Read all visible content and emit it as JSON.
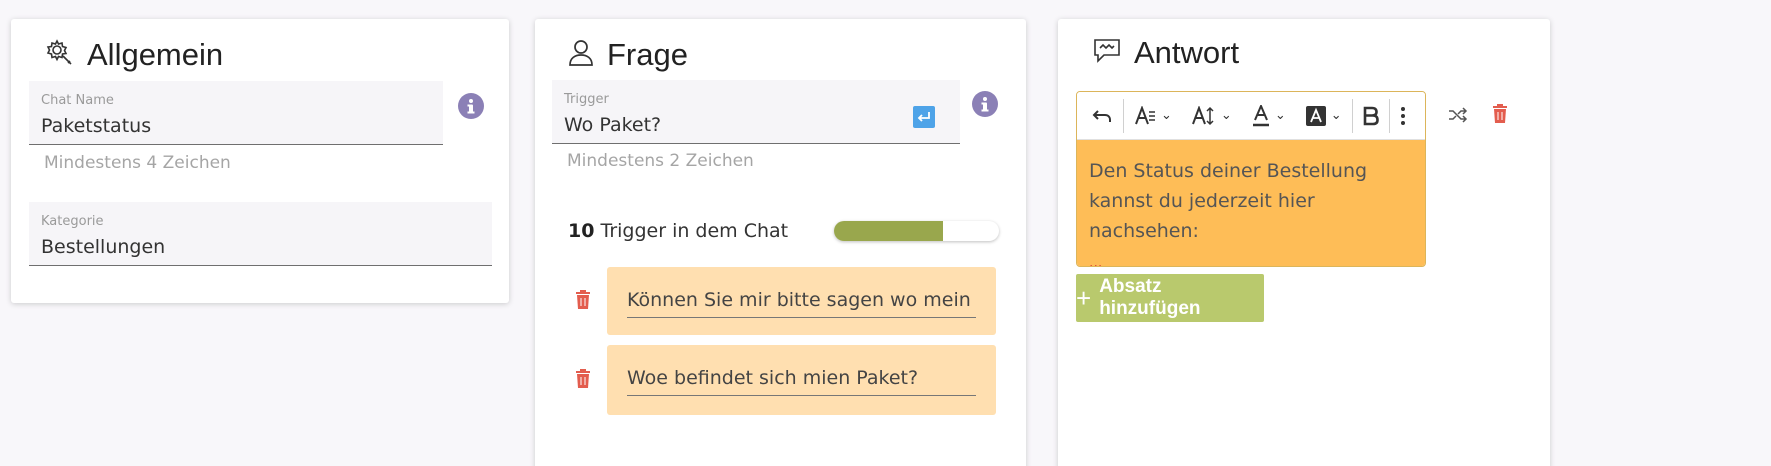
{
  "general": {
    "title": "Allgemein",
    "icon": "settings-wrench-icon",
    "chat_name_label": "Chat Name",
    "chat_name_value": "Paketstatus",
    "chat_name_hint": "Mindestens 4 Zeichen",
    "category_label": "Kategorie",
    "category_value": "Bestellungen"
  },
  "question": {
    "title": "Frage",
    "icon": "person-icon",
    "trigger_label": "Trigger",
    "trigger_value": "Wo Paket?",
    "trigger_hint": "Mindestens 2 Zeichen",
    "trigger_count": "10",
    "trigger_count_label": "Trigger in dem Chat",
    "trigger_progress": 0.66,
    "progress_color": "#99a74d",
    "triggers": [
      "Können Sie mir bitte sagen wo mein Paket sich befindet?",
      "Woe befindet sich mien Paket?"
    ]
  },
  "answer": {
    "title": "Antwort",
    "icon": "chat-bubble-icon",
    "toolbar": [
      "undo-icon",
      "font-style-icon",
      "font-size-icon",
      "font-color-icon",
      "highlight-icon",
      "bold-icon",
      "more-icon"
    ],
    "text": "Den Status deiner Bestellung kannst du jederzeit hier nachsehen:",
    "link_marker": "...",
    "add_paragraph_label": "Absatz hinzufügen",
    "editor_color": "#febd57",
    "button_color": "#b9c96d"
  }
}
